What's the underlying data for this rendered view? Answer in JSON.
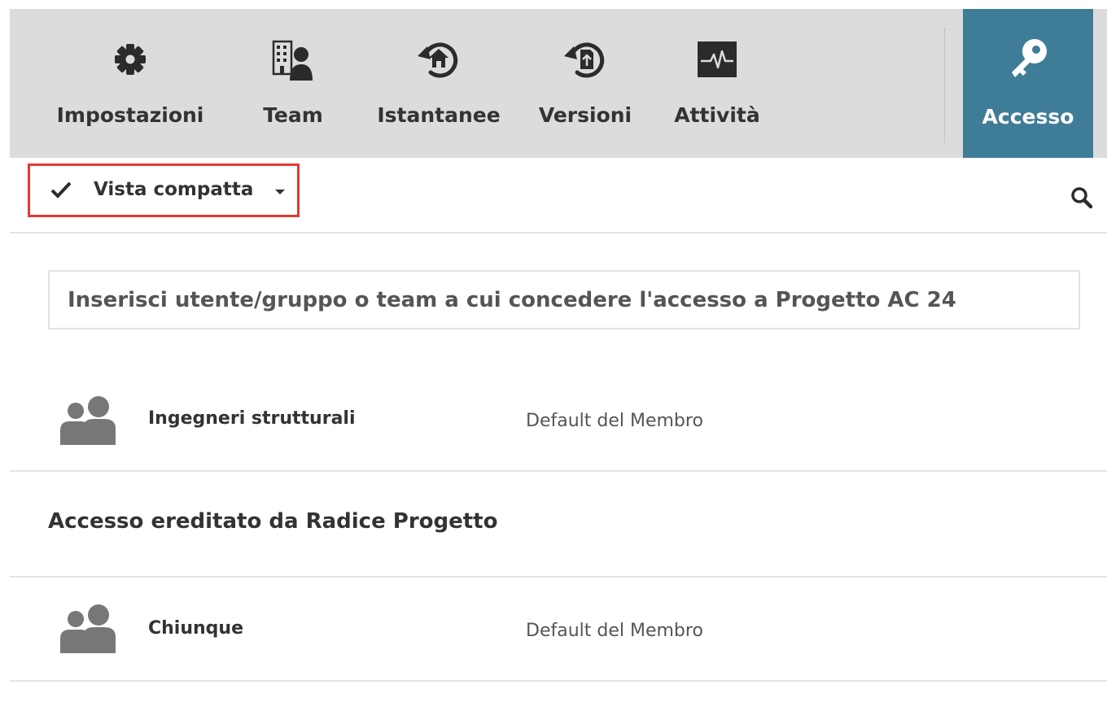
{
  "toolbar": {
    "items": [
      {
        "label": "Impostazioni",
        "icon": "gear-icon"
      },
      {
        "label": "Team",
        "icon": "building-user-icon"
      },
      {
        "label": "Istantanee",
        "icon": "snapshot-history-icon"
      },
      {
        "label": "Versioni",
        "icon": "version-history-icon"
      },
      {
        "label": "Attività",
        "icon": "activity-pulse-icon"
      }
    ],
    "active": {
      "label": "Accesso",
      "icon": "key-icon"
    },
    "active_color": "#3f7c97",
    "background_color": "#dcdcdc"
  },
  "subbar": {
    "view_toggle_label": "Vista compatta",
    "view_toggle_checked": true,
    "highlight_color": "#e53935"
  },
  "grant_input": {
    "placeholder": "Inserisci utente/gruppo o team a cui concedere l'accesso a Progetto AC 24"
  },
  "direct_access": [
    {
      "name": "Ingegneri strutturali",
      "role": "Default del Membro",
      "icon": "group-icon"
    }
  ],
  "inherited_section": {
    "heading": "Accesso ereditato da Radice Progetto",
    "items": [
      {
        "name": "Chiunque",
        "role": "Default del Membro",
        "icon": "group-icon"
      }
    ]
  }
}
